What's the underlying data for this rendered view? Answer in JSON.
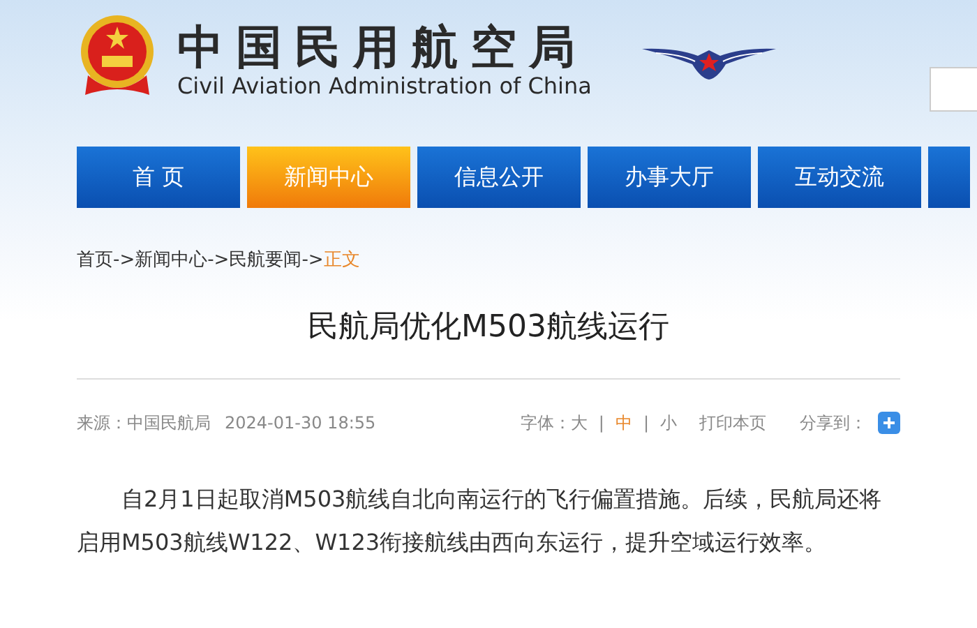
{
  "header": {
    "title": "中国民用航空局",
    "subtitle": "Civil Aviation Administration of China"
  },
  "nav": [
    {
      "label": "首 页",
      "selected": false
    },
    {
      "label": "新闻中心",
      "selected": true
    },
    {
      "label": "信息公开",
      "selected": false
    },
    {
      "label": "办事大厅",
      "selected": false
    },
    {
      "label": "互动交流",
      "selected": false
    }
  ],
  "breadcrumb": {
    "separator": "->",
    "items": [
      {
        "label": "首页",
        "current": false
      },
      {
        "label": "新闻中心",
        "current": false
      },
      {
        "label": "民航要闻",
        "current": false
      },
      {
        "label": "正文",
        "current": true
      }
    ]
  },
  "article": {
    "title": "民航局优化M503航线运行",
    "source": "来源：中国民航局",
    "date": "2024-01-30 18:55",
    "font_label": "字体：",
    "font_sizes": [
      {
        "label": "大",
        "selected": false
      },
      {
        "label": "中",
        "selected": true
      },
      {
        "label": "小",
        "selected": false
      }
    ],
    "font_divider": "|",
    "print": "打印本页",
    "share": "分享到：",
    "body": "自2月1日起取消M503航线自北向南运行的飞行偏置措施。后续，民航局还将启用M503航线W122、W123衔接航线由西向东运行，提升空域运行效率。"
  }
}
